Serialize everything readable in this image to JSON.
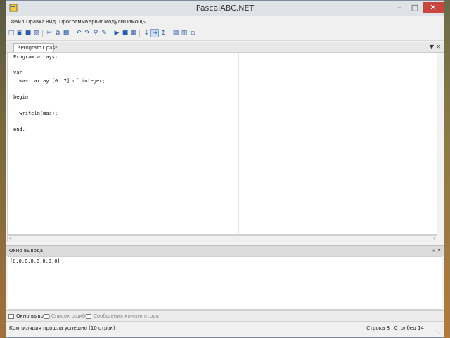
{
  "window": {
    "title": "PascalABC.NET"
  },
  "menu": [
    "Файл",
    "Правка",
    "Вид",
    "Программа",
    "Сервис",
    "Модули",
    "Помощь"
  ],
  "editor_tab": {
    "label": "*Program1.pas*"
  },
  "code": [
    {
      "text": "Program arrays;"
    },
    {
      "text": ""
    },
    {
      "text": "var"
    },
    {
      "text": "  mas: array [0..7] of integer;"
    },
    {
      "text": ""
    },
    {
      "text": "begin"
    },
    {
      "text": ""
    },
    {
      "text": "  writeln(mas);"
    },
    {
      "text": ""
    },
    {
      "text": "end."
    }
  ],
  "output": {
    "title": "Окно вывода",
    "text": "[0,0,0,0,0,0,0,0]"
  },
  "bottom_tabs": [
    {
      "label": "Окно вывода"
    },
    {
      "label": "Список ошибок"
    },
    {
      "label": "Сообщения компилятора"
    }
  ],
  "status": {
    "message": "Компиляция прошла успешно (10 строк)",
    "line_label": "Строка",
    "line": "8",
    "col_label": "Столбец",
    "col": "14"
  }
}
